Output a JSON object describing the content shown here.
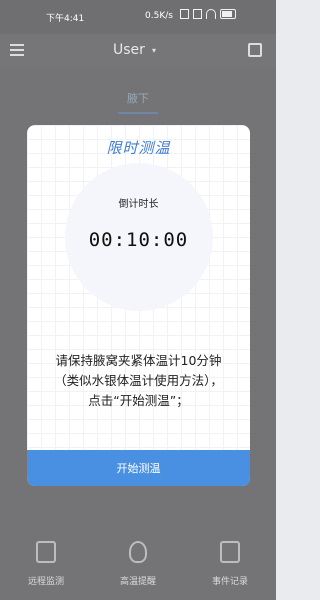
{
  "status_bar": {
    "time": "下午4:41",
    "network_speed": "0.5K/s"
  },
  "header": {
    "title": "User"
  },
  "tabs": {
    "active": "腋下"
  },
  "dialog": {
    "title": "限时测温",
    "countdown_label": "倒计时长",
    "countdown_value": "00:10:00",
    "instruction_line1": "请保持腋窝夹紧体温计10分钟",
    "instruction_line2": "（类似水银体温计使用方法），",
    "instruction_line3": "点击“开始测温”；",
    "start_button": "开始测温",
    "accent_color": "#4a90e2"
  },
  "bottom_nav": [
    {
      "label": "远程监测",
      "icon": "chart-icon"
    },
    {
      "label": "高温提醒",
      "icon": "thermometer-bulb-icon"
    },
    {
      "label": "事件记录",
      "icon": "record-icon"
    }
  ]
}
